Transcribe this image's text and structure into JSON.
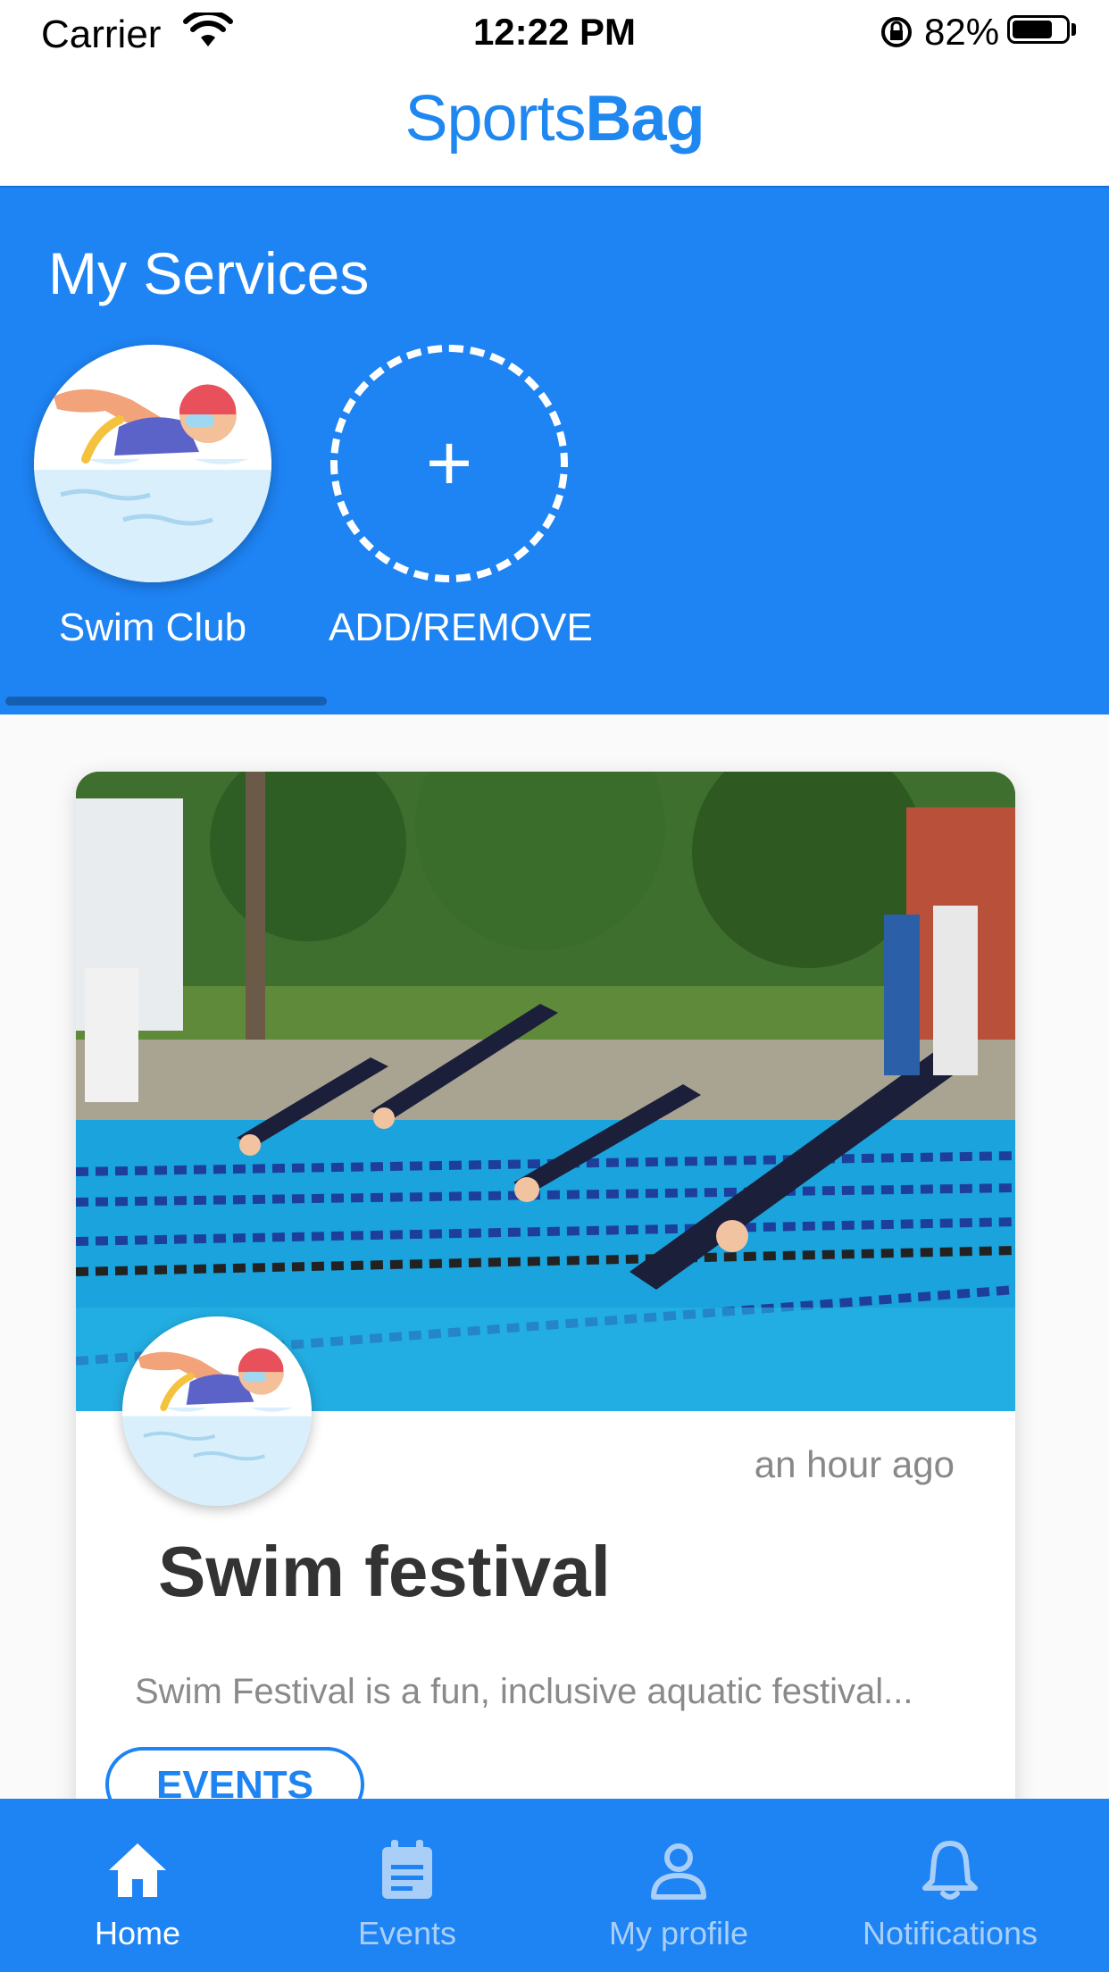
{
  "status_bar": {
    "carrier": "Carrier",
    "time": "12:22 PM",
    "battery_percent": "82%",
    "battery_level": 0.82
  },
  "header": {
    "logo_light": "Sports",
    "logo_bold": "Bag",
    "brand_color": "#1e87f0"
  },
  "services": {
    "title": "My Services",
    "items": [
      {
        "label": "Swim Club",
        "icon": "swimmer-icon"
      },
      {
        "label": "ADD/REMOVE",
        "icon": "plus-icon"
      }
    ],
    "background_color": "#1e83f3"
  },
  "feed": {
    "cards": [
      {
        "time": "an hour ago",
        "title": "Swim festival",
        "description": "Swim Festival is a fun, inclusive aquatic festival...",
        "tag": "EVENTS",
        "image": "swimmers-diving-photo",
        "avatar_icon": "swimmer-icon"
      }
    ]
  },
  "tab_bar": {
    "tabs": [
      {
        "label": "Home",
        "icon": "home-icon",
        "active": true
      },
      {
        "label": "Events",
        "icon": "calendar-icon",
        "active": false
      },
      {
        "label": "My profile",
        "icon": "person-icon",
        "active": false
      },
      {
        "label": "Notifications",
        "icon": "bell-icon",
        "active": false
      }
    ]
  }
}
